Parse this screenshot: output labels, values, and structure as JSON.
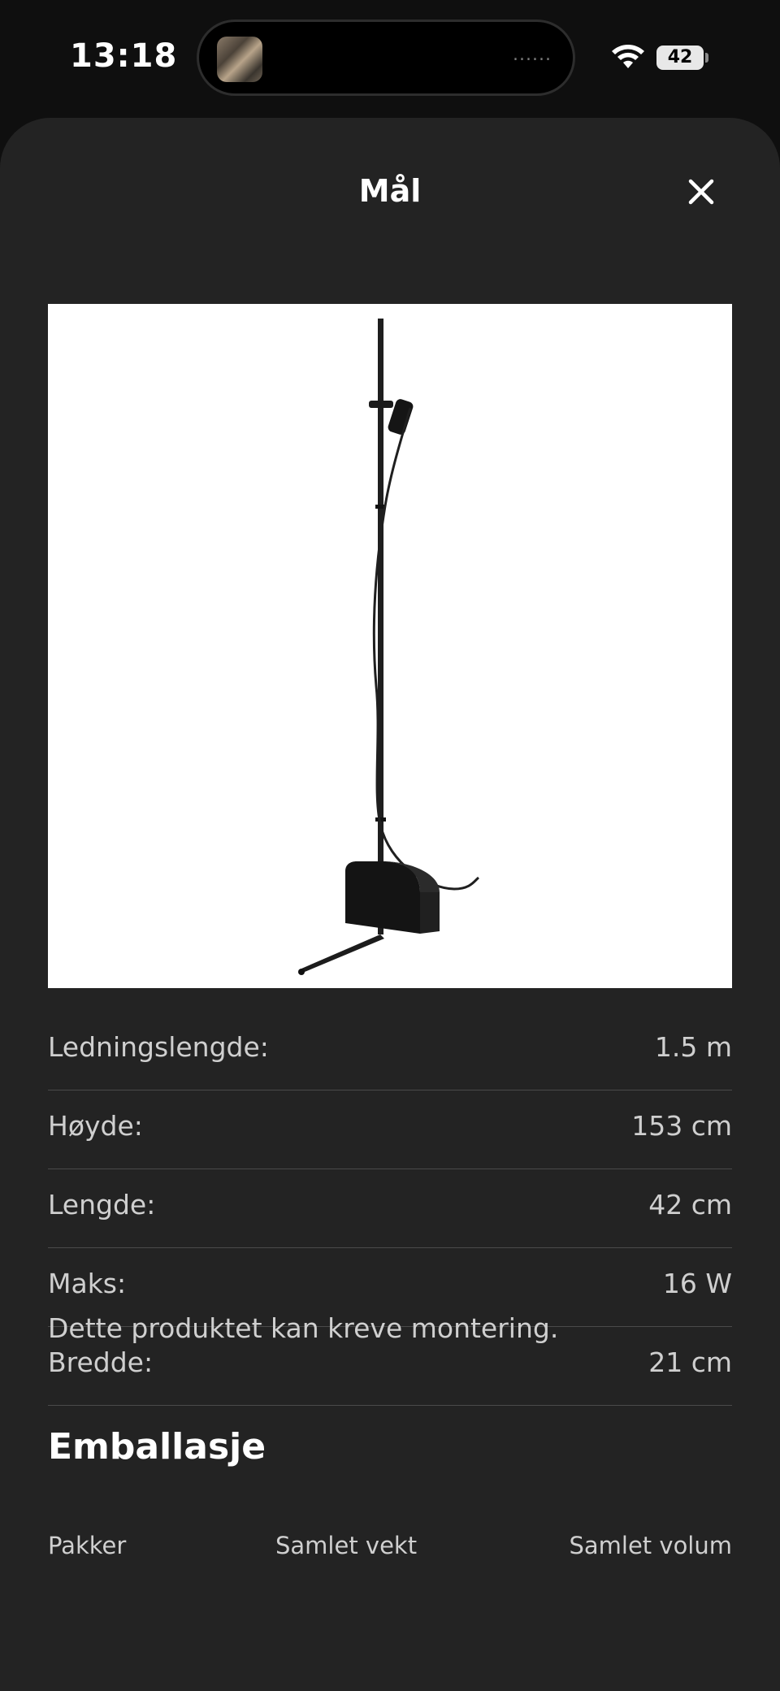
{
  "status_bar": {
    "time": "13:18",
    "battery": "42",
    "island_indicator": "......"
  },
  "sheet": {
    "title": "Mål",
    "close_icon": "close-icon"
  },
  "product": {
    "image_icon": "floor-lamp-image"
  },
  "specs": [
    {
      "label": "Ledningslengde:",
      "value": "1.5 m"
    },
    {
      "label": "Høyde:",
      "value": "153 cm"
    },
    {
      "label": "Lengde:",
      "value": "42 cm"
    },
    {
      "label": "Maks:",
      "value": "16 W"
    },
    {
      "label": "Bredde:",
      "value": "21 cm"
    }
  ],
  "note": "Dette produktet kan kreve montering.",
  "packaging": {
    "heading": "Emballasje",
    "columns": [
      "Pakker",
      "Samlet vekt",
      "Samlet volum"
    ]
  }
}
